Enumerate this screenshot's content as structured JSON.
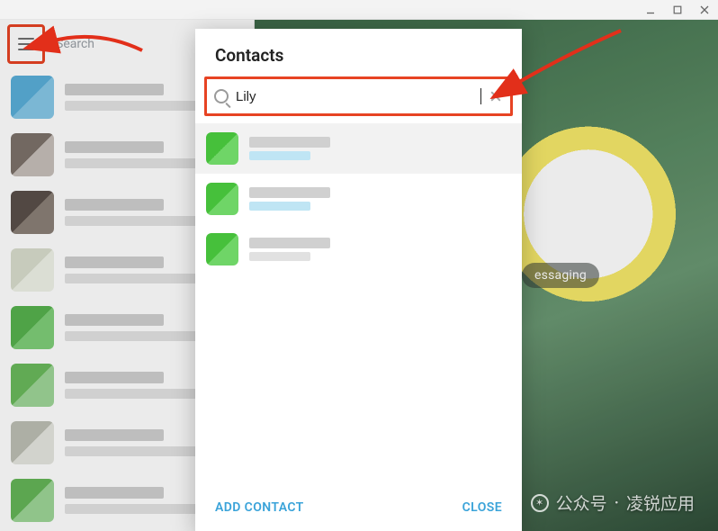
{
  "window": {
    "minimize_tip": "Minimize",
    "maximize_tip": "Maximize",
    "close_tip": "Close"
  },
  "sidebar": {
    "search_placeholder": "Search"
  },
  "main_chip_text": "essaging",
  "modal": {
    "title": "Contacts",
    "search_value": "Lily",
    "add_contact_label": "ADD CONTACT",
    "close_label": "CLOSE"
  },
  "watermark": {
    "prefix": "公众号",
    "sep": "·",
    "name": "凌锐应用"
  }
}
